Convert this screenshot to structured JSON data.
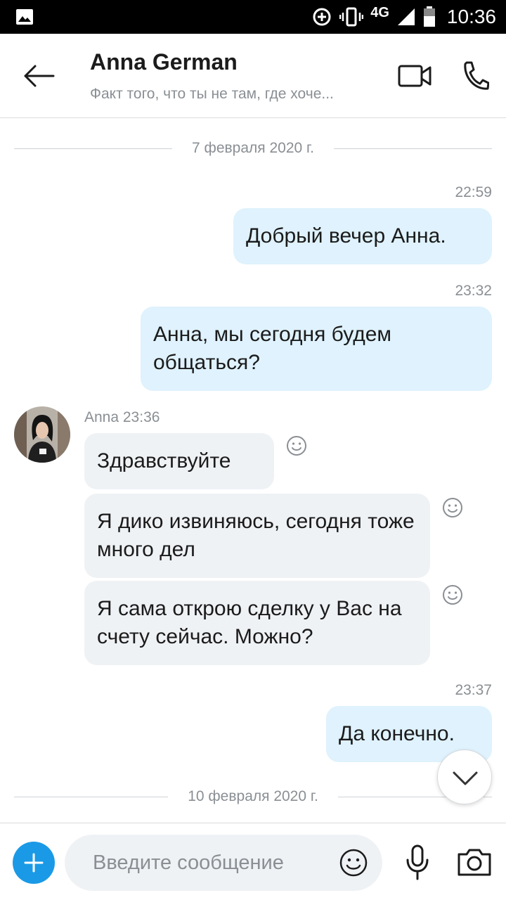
{
  "status_bar": {
    "time": "10:36",
    "network": "4G"
  },
  "header": {
    "contact_name": "Anna German",
    "status_message": "Факт того, что ты не там, где хоче..."
  },
  "dates": {
    "first": "7 февраля 2020 г.",
    "second": "10 февраля 2020 г."
  },
  "messages": [
    {
      "time": "22:59",
      "text": "Добрый вечер Анна."
    },
    {
      "time": "23:32",
      "text": "Анна, мы сегодня будем общаться?"
    },
    {
      "sender_line": "Anna 23:36",
      "text": "Здравствуйте"
    },
    {
      "text": "Я дико извиняюсь, сегодня тоже много дел"
    },
    {
      "text": "Я сама открою сделку у Вас на счету сейчас. Можно?"
    },
    {
      "time": "23:37",
      "text": "Да конечно."
    }
  ],
  "composer": {
    "placeholder": "Введите сообщение"
  },
  "colors": {
    "accent": "#1a9ae6",
    "outgoing_bubble": "#dff2fd",
    "incoming_bubble": "#eff2f5"
  },
  "icons": [
    "back-arrow-icon",
    "video-call-icon",
    "phone-icon",
    "smiley-icon",
    "chevron-down-icon",
    "plus-icon",
    "microphone-icon",
    "camera-icon"
  ]
}
